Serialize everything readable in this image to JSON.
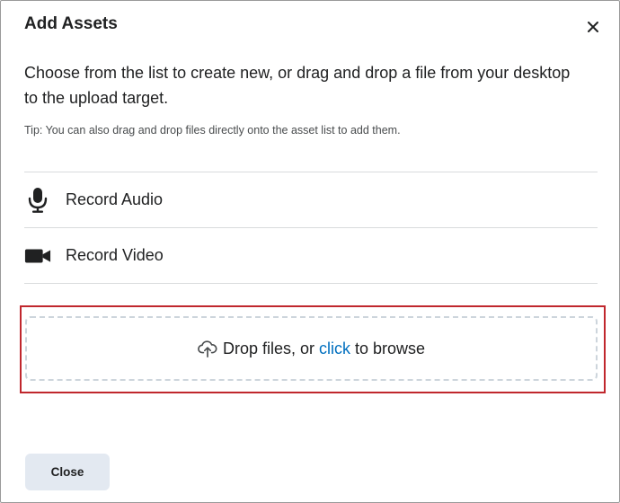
{
  "dialog": {
    "title": "Add Assets",
    "intro": "Choose from the list to create new, or drag and drop a file from your desktop to the upload target.",
    "tip": "Tip: You can also drag and drop files directly onto the asset list to add them.",
    "items": [
      {
        "label": "Record Audio",
        "icon": "microphone-icon"
      },
      {
        "label": "Record Video",
        "icon": "video-camera-icon"
      }
    ],
    "dropzone": {
      "prefix": "Drop files, or",
      "link": "click",
      "suffix": "to browse",
      "icon": "cloud-upload-icon"
    },
    "close_label": "Close",
    "close_icon": "close-icon"
  },
  "colors": {
    "link": "#006fbf",
    "highlight": "#c0272d",
    "button_bg": "#e3e9f1"
  }
}
